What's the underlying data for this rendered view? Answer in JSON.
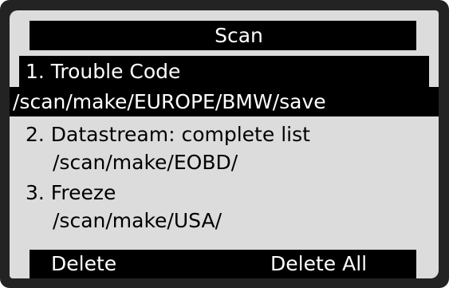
{
  "screen": {
    "title": "Scan"
  },
  "menu": {
    "items": [
      {
        "title": "1. Trouble Code",
        "path": "/scan/make/EUROPE/BMW/save",
        "selected": true
      },
      {
        "title": "2. Datastream: complete list",
        "path": "/scan/make/EOBD/",
        "selected": false
      },
      {
        "title": "3. Freeze",
        "path": "/scan/make/USA/",
        "selected": false
      }
    ]
  },
  "softkeys": {
    "left_label": "Delete",
    "right_label": "Delete All"
  },
  "colors": {
    "screen_background": "#dcdcdc",
    "highlight": "#000000",
    "highlight_text": "#ffffff",
    "bezel": "#232323"
  }
}
